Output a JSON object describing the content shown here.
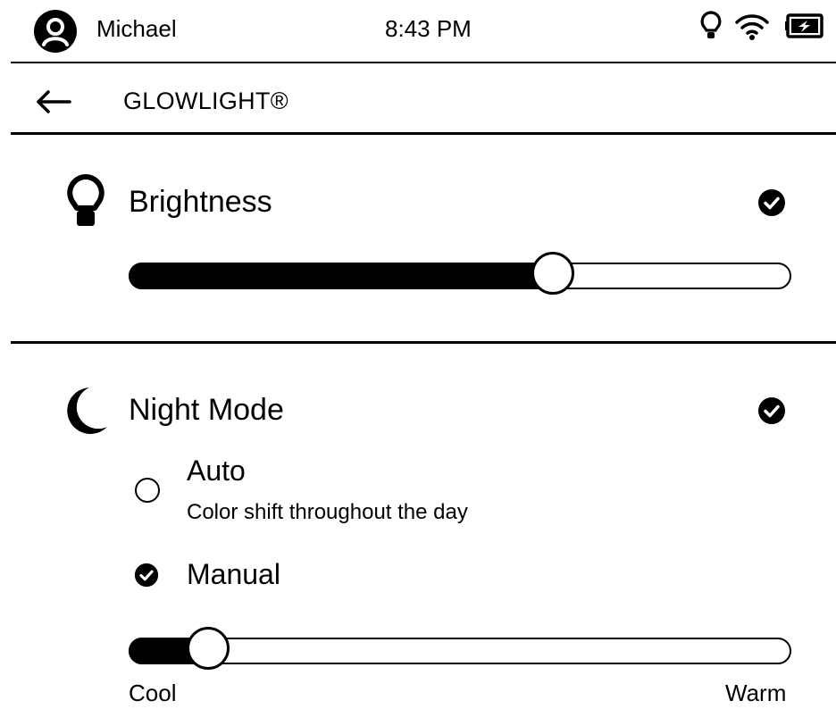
{
  "status": {
    "user": "Michael",
    "time": "8:43 PM",
    "icons": [
      "avatar-icon",
      "glowlight-on-icon",
      "wifi-icon",
      "battery-charging-icon"
    ]
  },
  "header": {
    "title": "GLOWLIGHT®",
    "back_icon": "arrow-left-icon"
  },
  "brightness": {
    "label": "Brightness",
    "icon": "bulb-icon",
    "enabled": true,
    "level": 0.64
  },
  "night_mode": {
    "label": "Night Mode",
    "icon": "moon-icon",
    "enabled": true,
    "options": [
      {
        "label": "Auto",
        "description": "Color shift throughout the day",
        "selected": false
      },
      {
        "label": "Manual",
        "selected": true
      }
    ],
    "color_temperature": {
      "min_label": "Cool",
      "max_label": "Warm",
      "level": 0.12
    }
  }
}
